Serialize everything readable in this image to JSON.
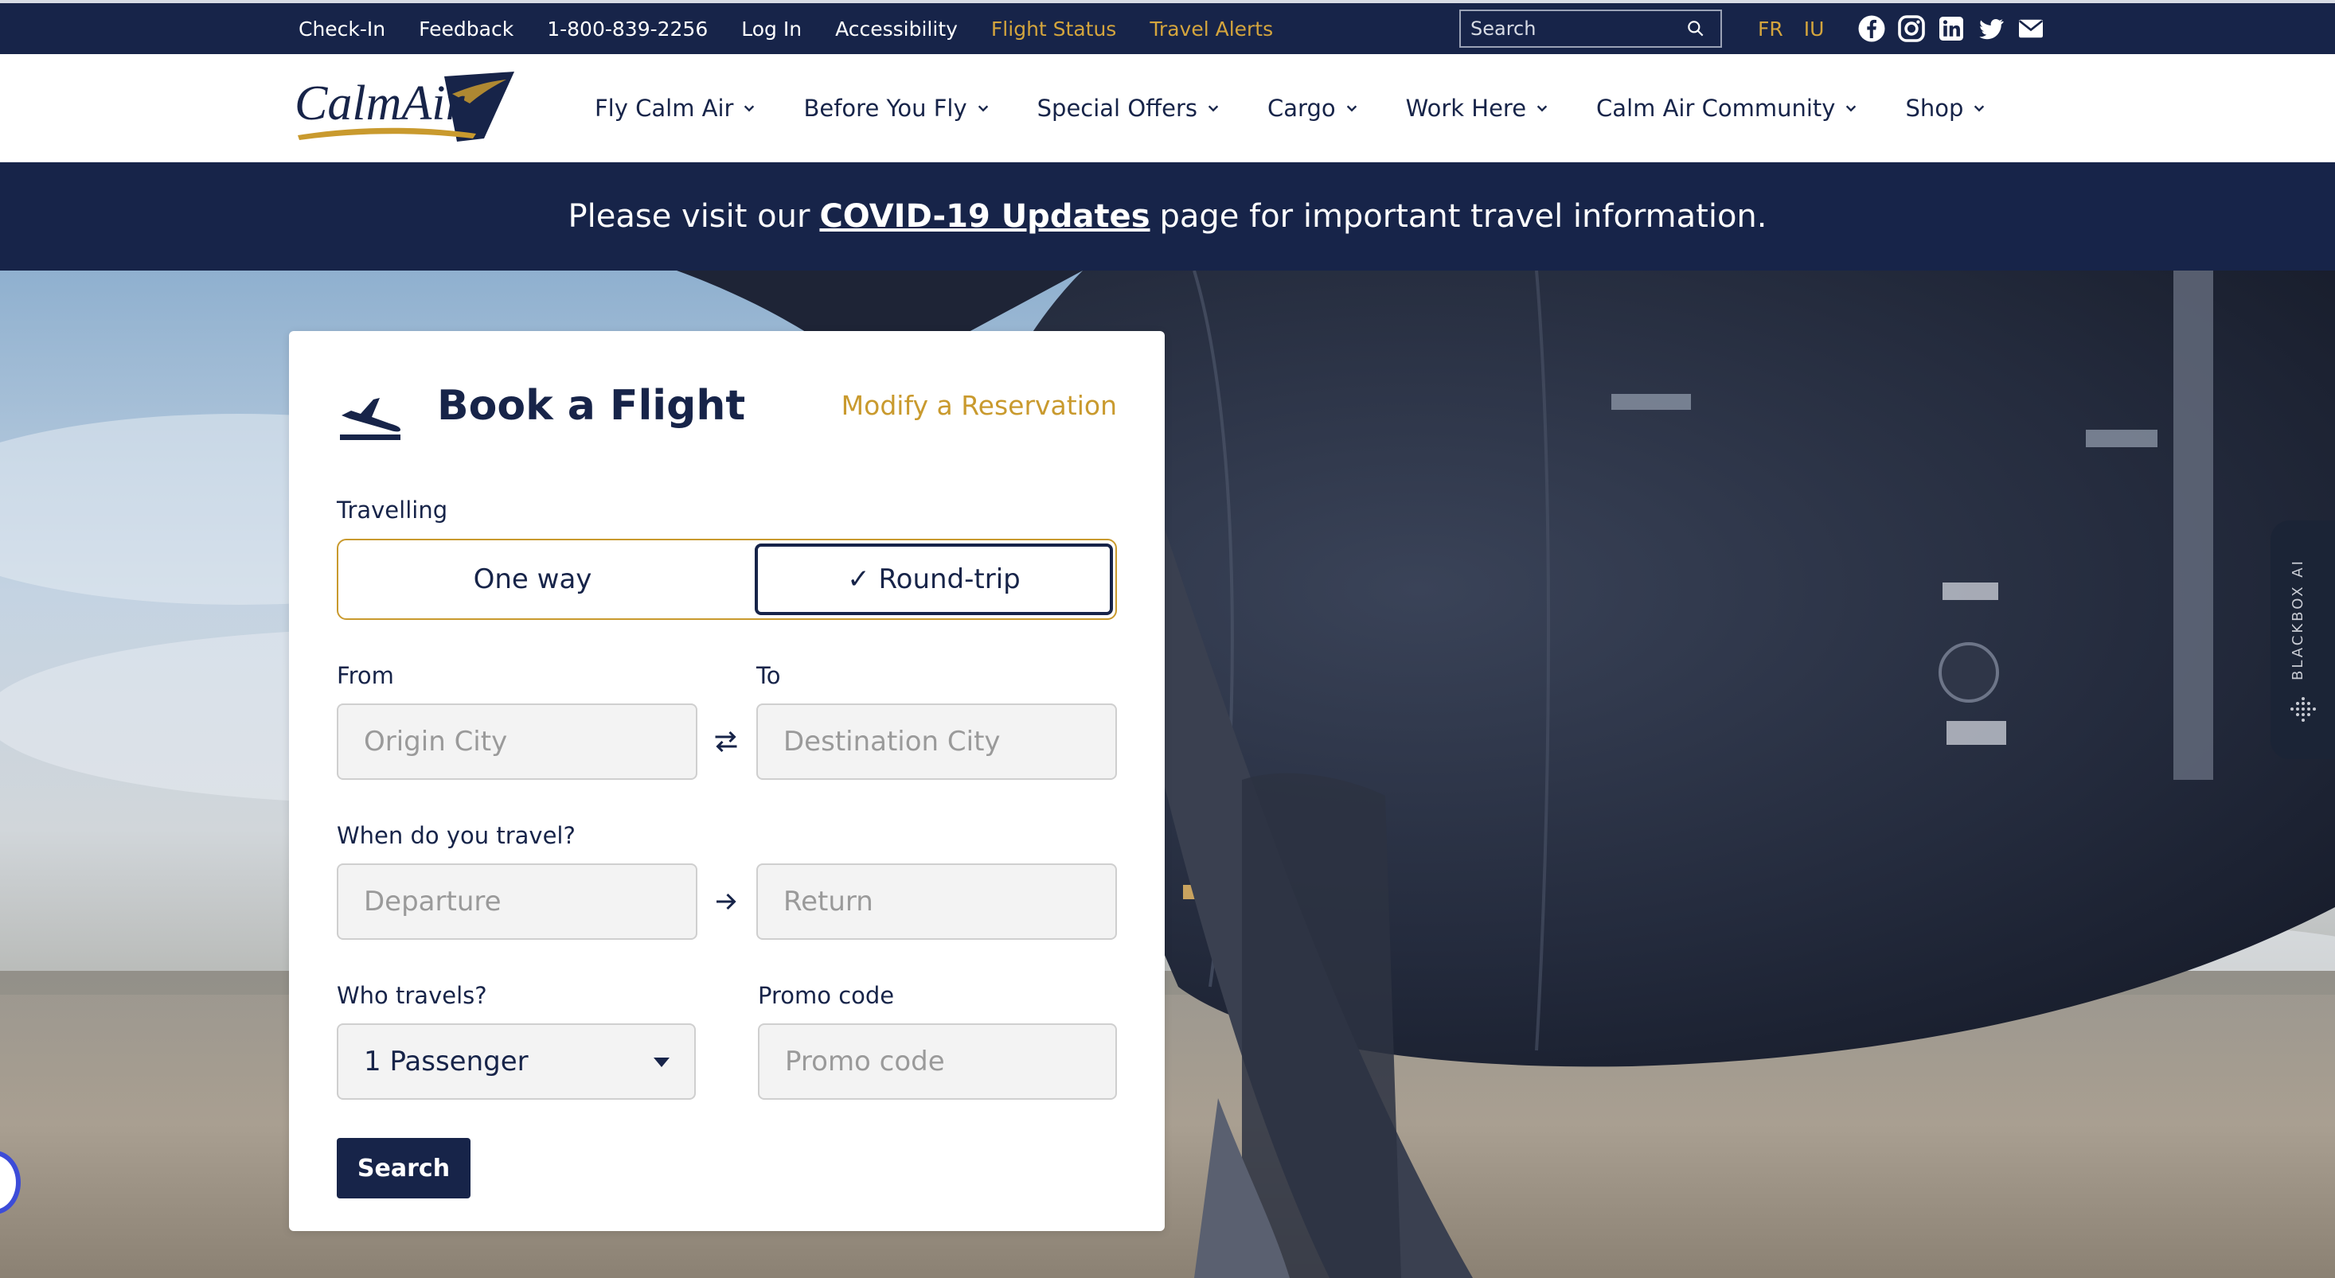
{
  "topbar": {
    "links": [
      "Check-In",
      "Feedback",
      "1-800-839-2256",
      "Log In",
      "Accessibility",
      "Flight Status",
      "Travel Alerts"
    ],
    "search_placeholder": "Search",
    "languages": [
      "FR",
      "IU"
    ],
    "social_icons": [
      "facebook-icon",
      "instagram-icon",
      "linkedin-icon",
      "twitter-icon",
      "email-icon"
    ],
    "highlight_color": "#d4a53d",
    "background_color": "#172449"
  },
  "nav": {
    "logo_text": "CalmAir",
    "items": [
      "Fly Calm Air",
      "Before You Fly",
      "Special Offers",
      "Cargo",
      "Work Here",
      "Calm Air Community",
      "Shop"
    ]
  },
  "banner": {
    "prefix": "Please visit our",
    "link": "COVID-19 Updates",
    "suffix": "page for important travel information."
  },
  "booking": {
    "title": "Book a Flight",
    "modify_link": "Modify a Reservation",
    "travelling_label": "Travelling",
    "one_way": "One way",
    "round_trip": "✓ Round-trip",
    "from_label": "From",
    "to_label": "To",
    "origin_placeholder": "Origin City",
    "destination_placeholder": "Destination City",
    "when_label": "When do you travel?",
    "departure_placeholder": "Departure",
    "return_placeholder": "Return",
    "who_label": "Who travels?",
    "passengers_value": "1 Passenger",
    "promo_label": "Promo code",
    "promo_placeholder": "Promo code",
    "search_button": "Search"
  },
  "side_widget": {
    "label": "BLACKBOX AI"
  }
}
